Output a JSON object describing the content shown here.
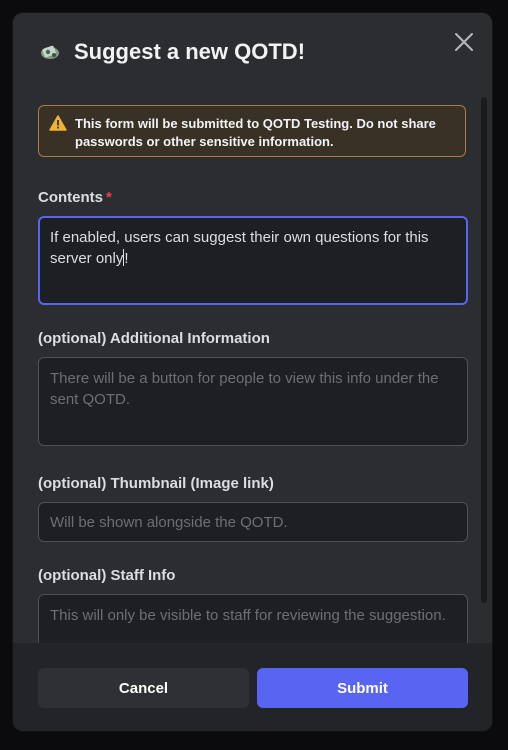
{
  "modal": {
    "title": "Suggest a new QOTD!",
    "close_icon": "close-icon",
    "app_icon": "bot-avatar-icon",
    "notice_parts": {
      "prefix": "This form will be submitted to ",
      "server": "QOTD Testing",
      "suffix": ". Do not share passwords or other sensitive information."
    },
    "fields": [
      {
        "label": "Contents",
        "required_mark": "*",
        "value_before_caret": "If enabled, users can suggest their own questions for this server only",
        "value_after_caret": "!"
      },
      {
        "label": "(optional) Additional Information",
        "placeholder": "There will be a button for people to view this info under the sent QOTD."
      },
      {
        "label": "(optional) Thumbnail (Image link)",
        "placeholder": "Will be shown alongside the QOTD."
      },
      {
        "label": "(optional) Staff Info",
        "placeholder": "This will only be visible to staff for reviewing the suggestion."
      }
    ],
    "buttons": {
      "cancel": "Cancel",
      "submit": "Submit"
    },
    "colors": {
      "accent": "#5865f2",
      "warning": "#f0b232",
      "required": "#f23f43"
    }
  }
}
